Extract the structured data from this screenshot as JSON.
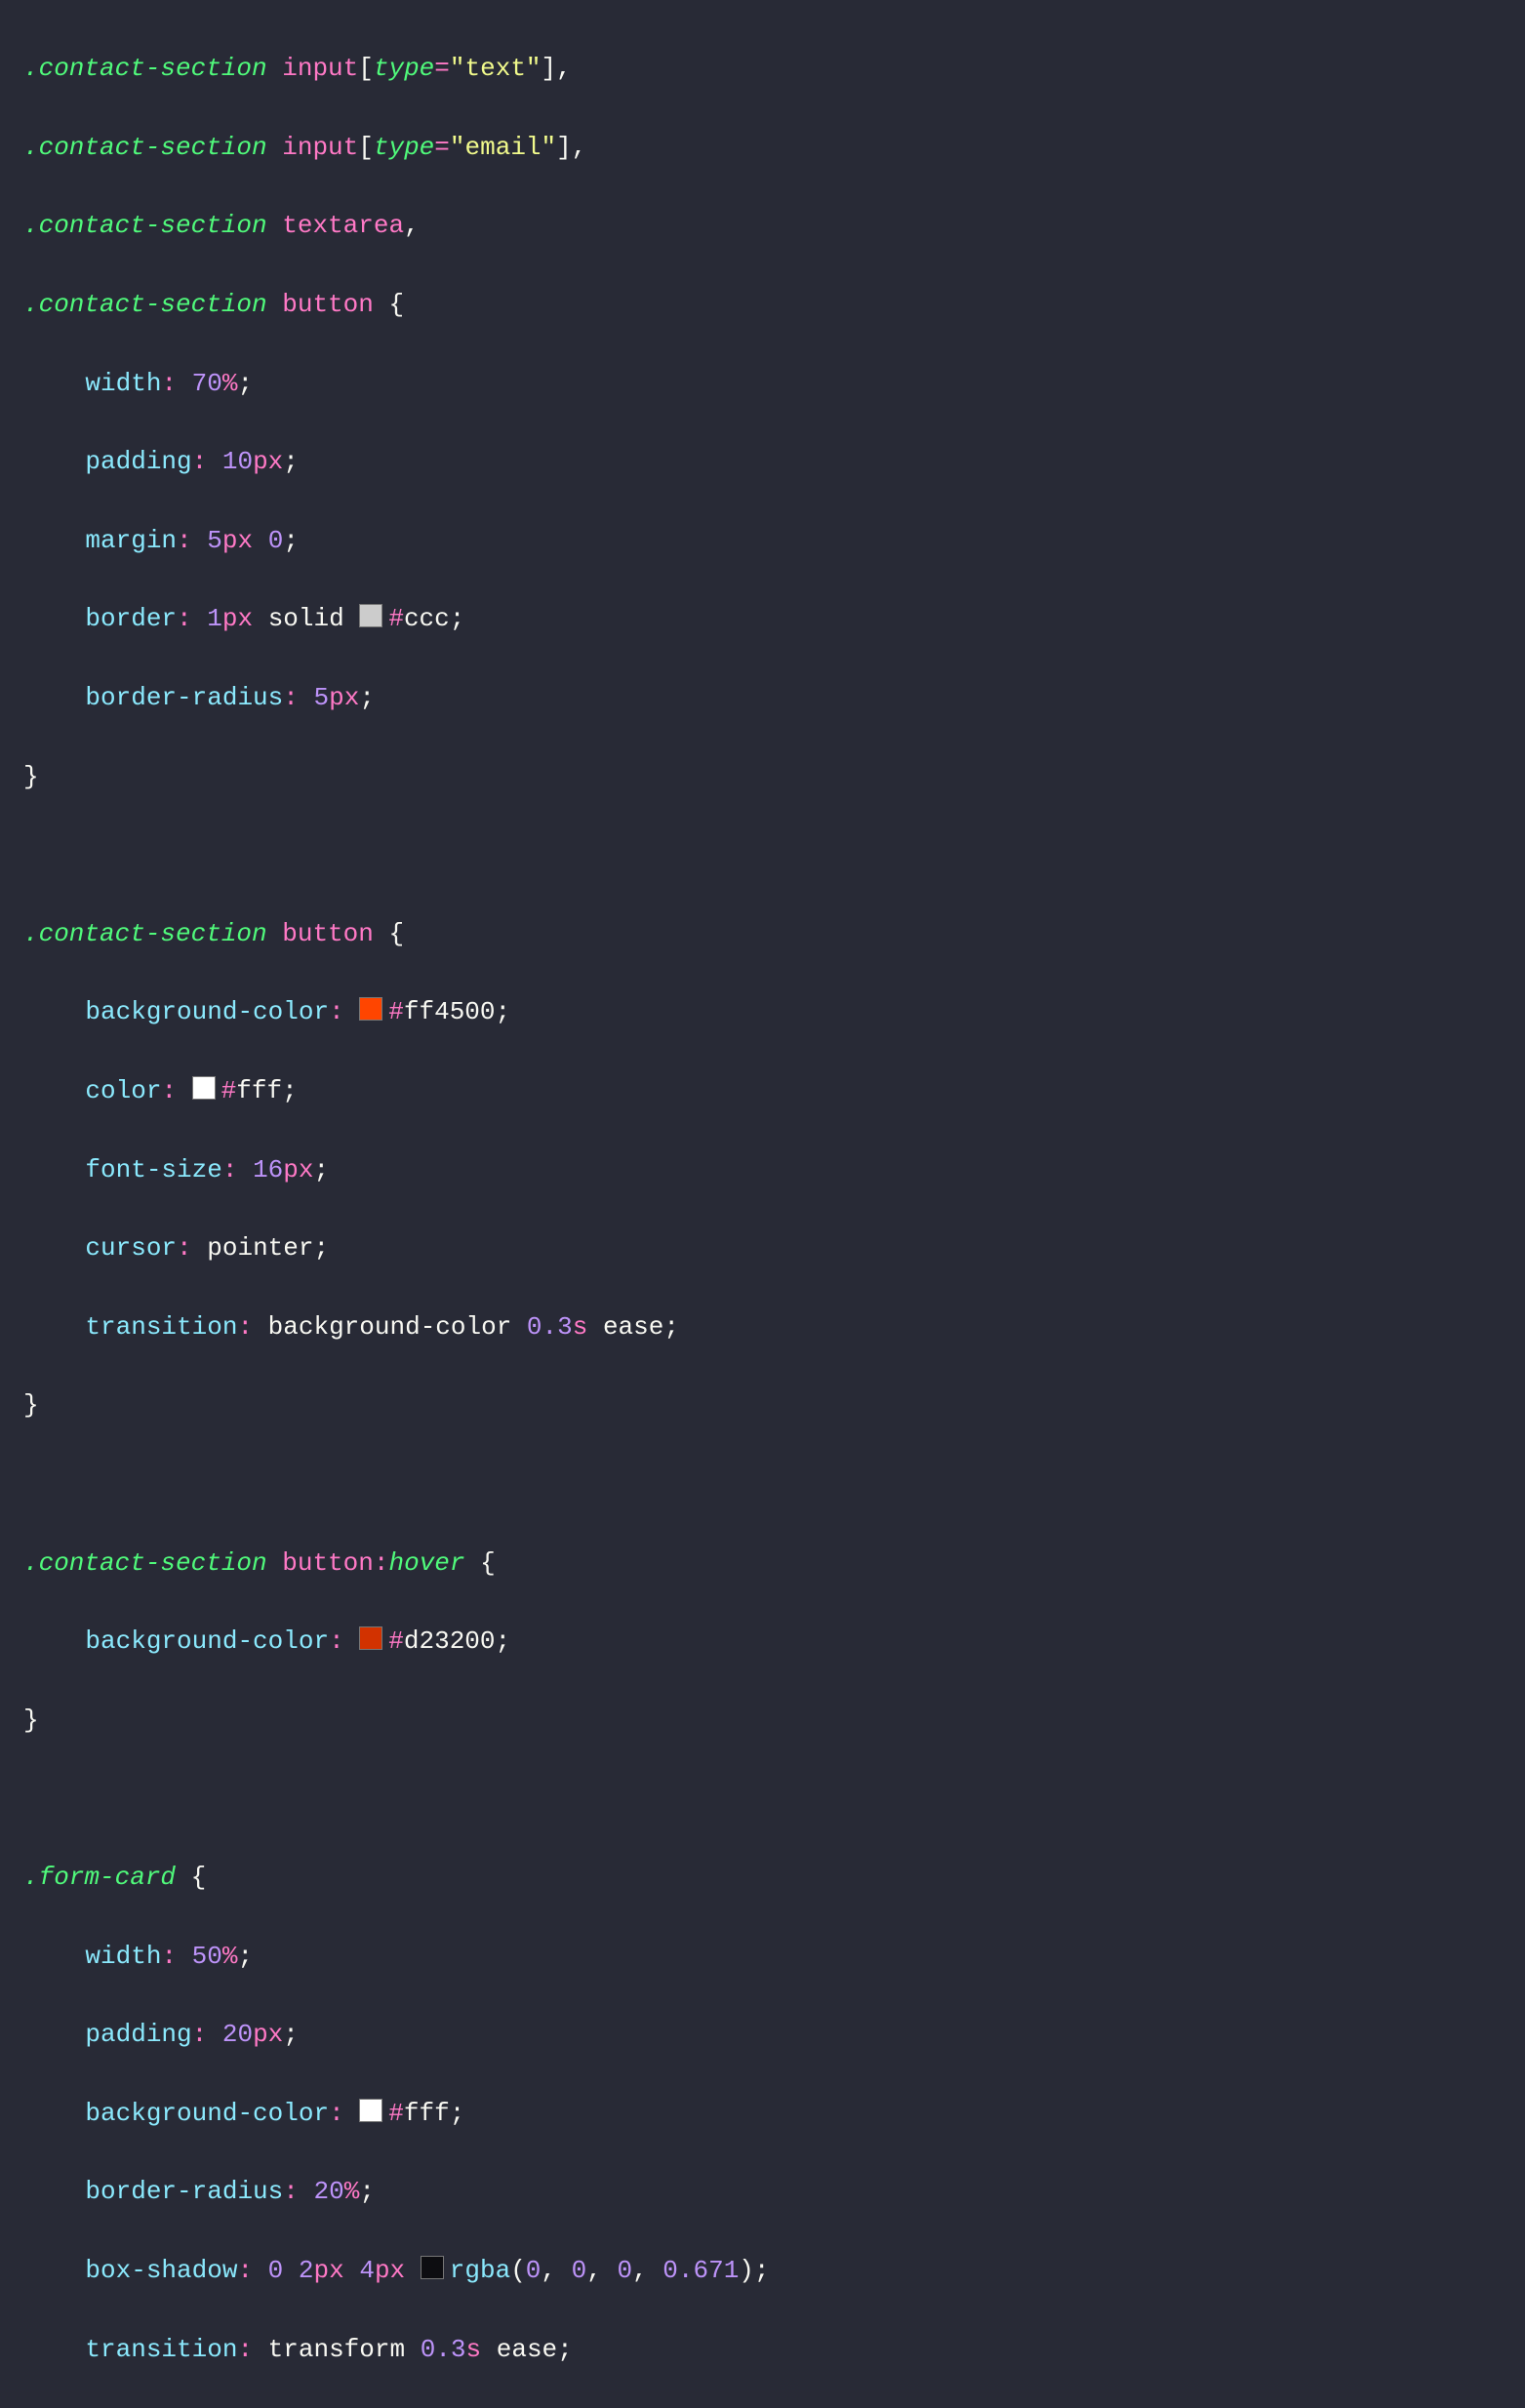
{
  "code": {
    "line1": {
      "sel": ".contact-section",
      "tag": "input",
      "lbr": "[",
      "attr": "type",
      "eq": "=",
      "str": "\"text\"",
      "rbr": "]",
      "comma": ","
    },
    "line2": {
      "sel": ".contact-section",
      "tag": "input",
      "lbr": "[",
      "attr": "type",
      "eq": "=",
      "str": "\"email\"",
      "rbr": "]",
      "comma": ","
    },
    "line3": {
      "sel": ".contact-section",
      "tag": "textarea",
      "comma": ","
    },
    "line4": {
      "sel": ".contact-section",
      "tag": "button",
      "brace": "{"
    },
    "line5": {
      "prop": "width",
      "colon": ":",
      "num": "70",
      "unit": "%",
      "semi": ";"
    },
    "line6": {
      "prop": "padding",
      "colon": ":",
      "num": "10",
      "unit": "px",
      "semi": ";"
    },
    "line7": {
      "prop": "margin",
      "colon": ":",
      "num1": "5",
      "unit1": "px",
      "num2": "0",
      "semi": ";"
    },
    "line8": {
      "prop": "border",
      "colon": ":",
      "num": "1",
      "unit": "px",
      "val": "solid",
      "swatch": "#cccccc",
      "hash": "#",
      "hex": "ccc",
      "semi": ";"
    },
    "line9": {
      "prop": "border-radius",
      "colon": ":",
      "num": "5",
      "unit": "px",
      "semi": ";"
    },
    "line10": {
      "brace": "}"
    },
    "line12": {
      "sel": ".contact-section",
      "tag": "button",
      "brace": "{"
    },
    "line13": {
      "prop": "background-color",
      "colon": ":",
      "swatch": "#ff4500",
      "hash": "#",
      "hex": "ff4500",
      "semi": ";"
    },
    "line14": {
      "prop": "color",
      "colon": ":",
      "swatch": "#ffffff",
      "hash": "#",
      "hex": "fff",
      "semi": ";"
    },
    "line15": {
      "prop": "font-size",
      "colon": ":",
      "num": "16",
      "unit": "px",
      "semi": ";"
    },
    "line16": {
      "prop": "cursor",
      "colon": ":",
      "val": "pointer",
      "semi": ";"
    },
    "line17": {
      "prop": "transition",
      "colon": ":",
      "val1": "background-color",
      "num": "0.3",
      "unit": "s",
      "val2": "ease",
      "semi": ";"
    },
    "line18": {
      "brace": "}"
    },
    "line20": {
      "sel": ".contact-section",
      "tag": "button",
      "pcolon": ":",
      "pseudo": "hover",
      "brace": "{"
    },
    "line21": {
      "prop": "background-color",
      "colon": ":",
      "swatch": "#d23200",
      "hash": "#",
      "hex": "d23200",
      "semi": ";"
    },
    "line22": {
      "brace": "}"
    },
    "line24": {
      "sel": ".form-card",
      "brace": "{"
    },
    "line25": {
      "prop": "width",
      "colon": ":",
      "num": "50",
      "unit": "%",
      "semi": ";"
    },
    "line26": {
      "prop": "padding",
      "colon": ":",
      "num": "20",
      "unit": "px",
      "semi": ";"
    },
    "line27": {
      "prop": "background-color",
      "colon": ":",
      "swatch": "#ffffff",
      "hash": "#",
      "hex": "fff",
      "semi": ";"
    },
    "line28": {
      "prop": "border-radius",
      "colon": ":",
      "num": "20",
      "unit": "%",
      "semi": ";"
    },
    "line29": {
      "prop": "box-shadow",
      "colon": ":",
      "n1": "0",
      "n2": "2",
      "u2": "px",
      "n3": "4",
      "u3": "px",
      "swatch": "rgba(0,0,0,0.671)",
      "func": "rgba",
      "lp": "(",
      "a1": "0",
      "c1": ",",
      "a2": "0",
      "c2": ",",
      "a3": "0",
      "c3": ",",
      "a4": "0.671",
      "rp": ")",
      "semi": ";"
    },
    "line30": {
      "prop": "transition",
      "colon": ":",
      "val1": "transform",
      "num": "0.3",
      "unit": "s",
      "val2": "ease",
      "semi": ";"
    }
  }
}
